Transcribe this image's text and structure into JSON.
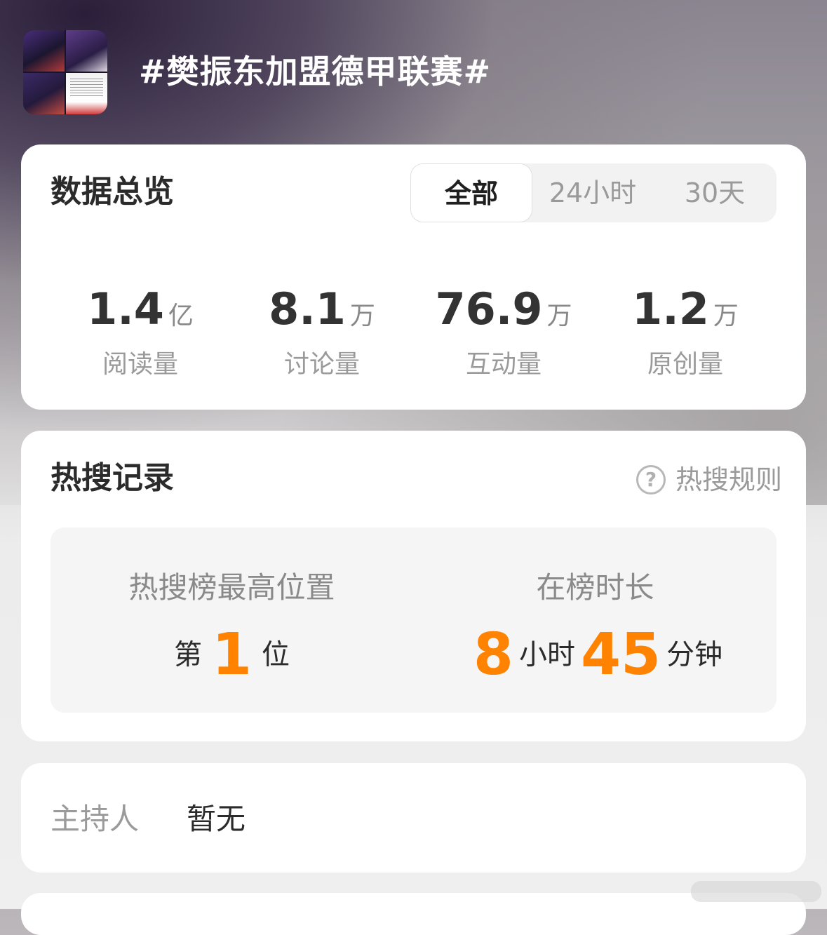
{
  "topic": {
    "title": "#樊振东加盟德甲联赛#"
  },
  "overview": {
    "title": "数据总览",
    "tabs": [
      {
        "label": "全部",
        "selected": true
      },
      {
        "label": "24小时",
        "selected": false
      },
      {
        "label": "30天",
        "selected": false
      }
    ],
    "stats": [
      {
        "value": "1.4",
        "unit": "亿",
        "label": "阅读量"
      },
      {
        "value": "8.1",
        "unit": "万",
        "label": "讨论量"
      },
      {
        "value": "76.9",
        "unit": "万",
        "label": "互动量"
      },
      {
        "value": "1.2",
        "unit": "万",
        "label": "原创量"
      }
    ]
  },
  "hot_search": {
    "title": "热搜记录",
    "rules_label": "热搜规则",
    "peak": {
      "label": "热搜榜最高位置",
      "prefix": "第",
      "rank": "1",
      "suffix": "位"
    },
    "duration": {
      "label": "在榜时长",
      "hours": "8",
      "hours_unit": "小时",
      "minutes": "45",
      "minutes_unit": "分钟"
    }
  },
  "host": {
    "label": "主持人",
    "value": "暂无"
  },
  "colors": {
    "accent": "#ff8200",
    "card": "#ffffff",
    "header_dark": "#2a1c3a"
  }
}
